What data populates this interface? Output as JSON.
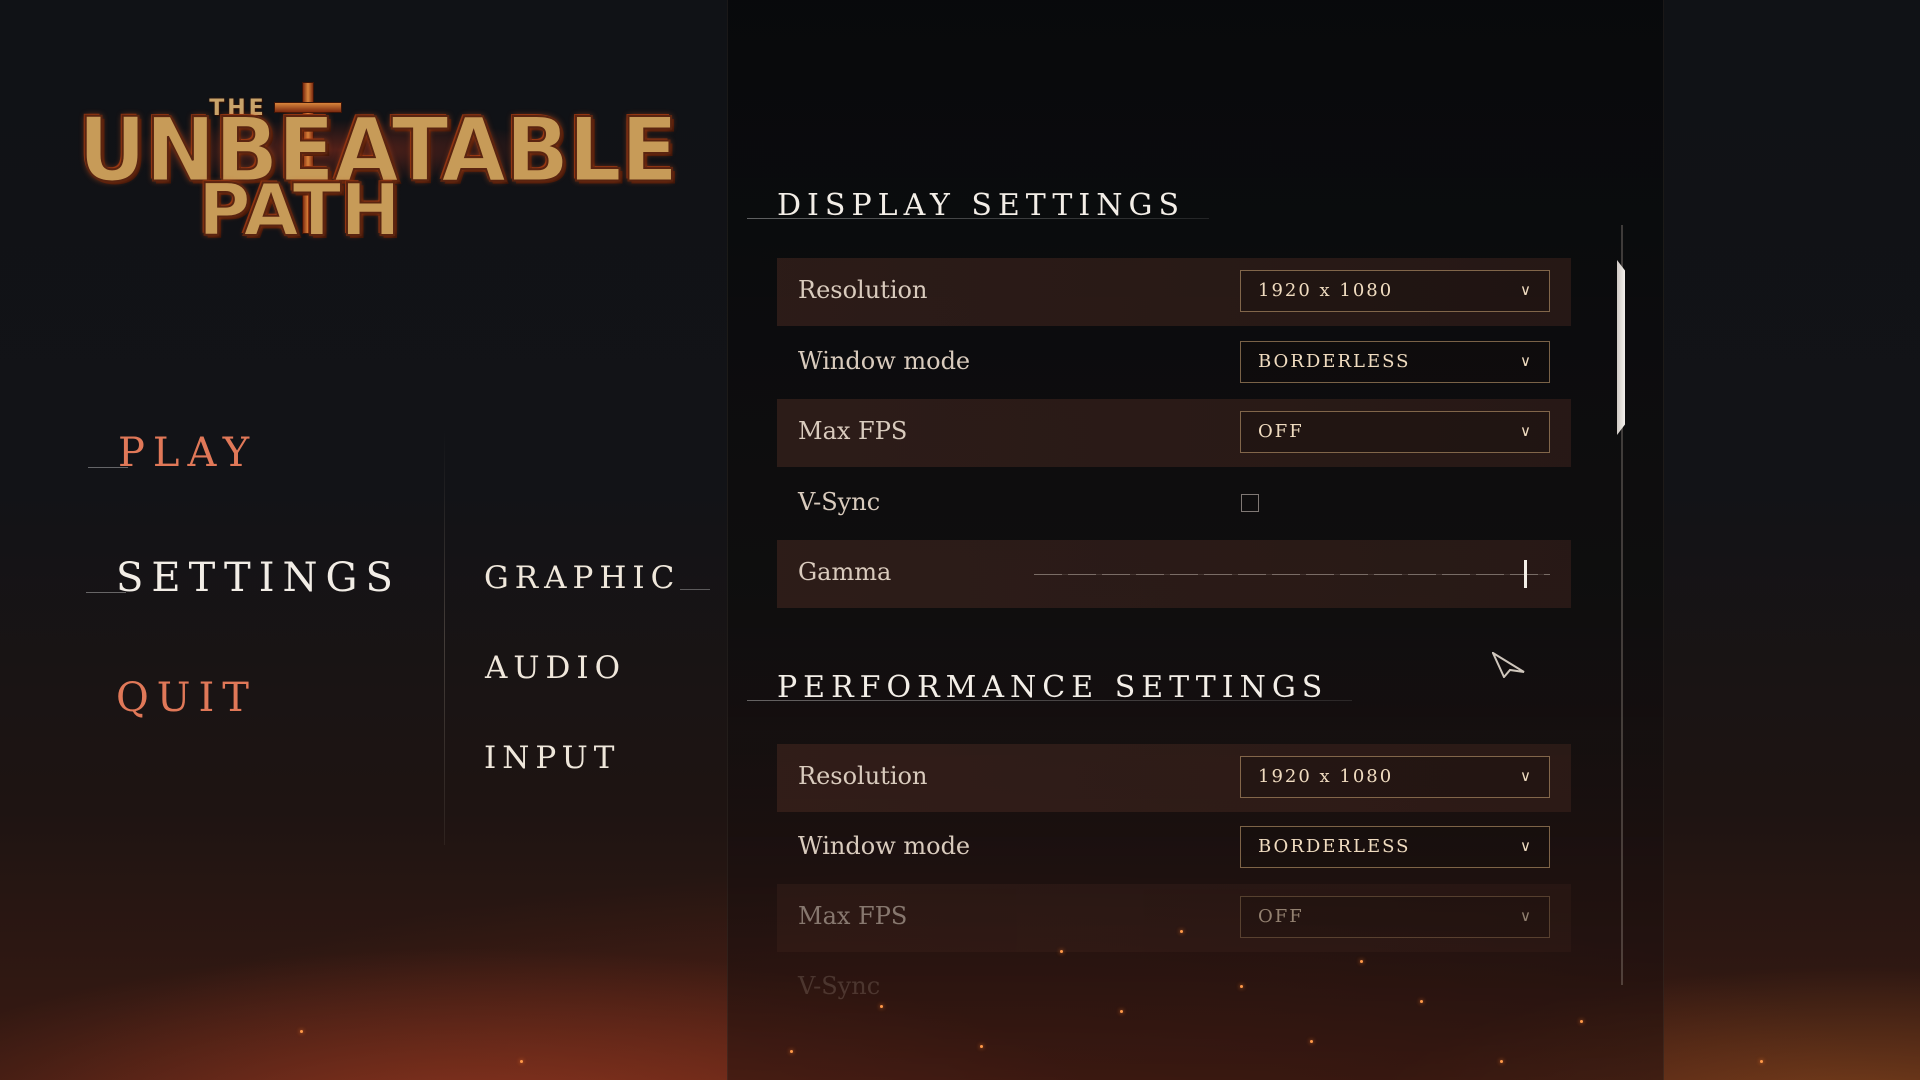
{
  "logo": {
    "small": "THE",
    "line1": "UNBEATABLE",
    "line2": "PATH"
  },
  "menu": {
    "play": "PLAY",
    "settings": "SETTINGS",
    "quit": "QUIT"
  },
  "submenu": {
    "graphic": "GRAPHIC",
    "audio": "AUDIO",
    "input": "INPUT"
  },
  "display": {
    "title": "DISPLAY SETTINGS",
    "resolution_label": "Resolution",
    "resolution_value": "1920 x 1080",
    "window_mode_label": "Window mode",
    "window_mode_value": "BORDERLESS",
    "max_fps_label": "Max FPS",
    "max_fps_value": "OFF",
    "vsync_label": "V-Sync",
    "gamma_label": "Gamma"
  },
  "performance": {
    "title": "PERFORMANCE SETTINGS",
    "resolution_label": "Resolution",
    "resolution_value": "1920 x 1080",
    "window_mode_label": "Window mode",
    "window_mode_value": "BORDERLESS",
    "max_fps_label": "Max FPS",
    "max_fps_value": "OFF",
    "vsync_label": "V-Sync"
  },
  "icons": {
    "dropdown": "chevron-down-icon",
    "cursor": "cursor-arrow-icon"
  },
  "state": {
    "vsync_checked": false,
    "gamma_level": 0.95
  },
  "colors": {
    "menu_accent": "#e07858",
    "active": "#f2ede6",
    "select_border": "#d2aa78"
  }
}
